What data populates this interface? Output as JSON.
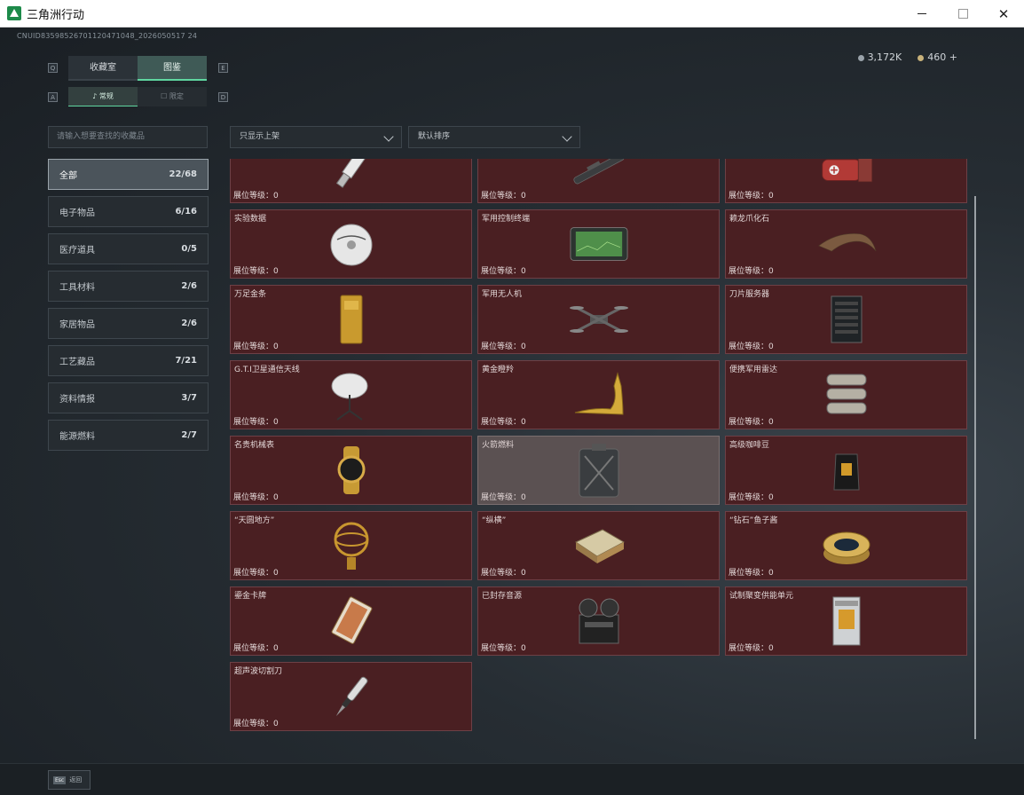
{
  "window": {
    "title": "三角洲行动",
    "controls": [
      "minimize",
      "maximize",
      "close"
    ]
  },
  "header": {
    "uid": "CNUID83598526701120471048_2026050517 24",
    "currency": [
      {
        "icon": "silver-coin-icon",
        "value": "3,172K"
      },
      {
        "icon": "gold-coin-icon",
        "value": "460 +"
      }
    ]
  },
  "key_hints": {
    "q": "Q",
    "e": "E",
    "a": "A",
    "d": "D"
  },
  "tabs": {
    "main": [
      "收藏室",
      "图鉴"
    ],
    "main_active": 1,
    "sub": [
      "常规",
      "限定"
    ],
    "sub_active": 0
  },
  "search": {
    "placeholder": "请输入想要查找的收藏品"
  },
  "filters": {
    "shelf": "只显示上架",
    "sort": "默认排序"
  },
  "categories": [
    {
      "label": "全部",
      "count": "22/68",
      "active": true
    },
    {
      "label": "电子物品",
      "count": "6/16"
    },
    {
      "label": "医疗道具",
      "count": "0/5"
    },
    {
      "label": "工具材料",
      "count": "2/6"
    },
    {
      "label": "家居物品",
      "count": "2/6"
    },
    {
      "label": "工艺藏品",
      "count": "7/21"
    },
    {
      "label": "资料情报",
      "count": "3/7"
    },
    {
      "label": "能源燃料",
      "count": "2/7"
    }
  ],
  "level_label": "展位等级：",
  "items": [
    {
      "name": "",
      "level": "0",
      "icon": "usb-drive-icon"
    },
    {
      "name": "",
      "level": "0",
      "icon": "rifle-scope-icon"
    },
    {
      "name": "",
      "level": "0",
      "icon": "medical-tank-icon"
    },
    {
      "name": "实验数据",
      "level": "0",
      "icon": "data-disc-icon"
    },
    {
      "name": "军用控制终端",
      "level": "0",
      "icon": "control-terminal-icon"
    },
    {
      "name": "赖龙爪化石",
      "level": "0",
      "icon": "fossil-claw-icon"
    },
    {
      "name": "万足金条",
      "level": "0",
      "icon": "gold-bar-icon"
    },
    {
      "name": "军用无人机",
      "level": "0",
      "icon": "drone-icon"
    },
    {
      "name": "刀片服务器",
      "level": "0",
      "icon": "blade-server-icon"
    },
    {
      "name": "G.T.I卫星通信天线",
      "level": "0",
      "icon": "satellite-antenna-icon"
    },
    {
      "name": "黄金瞪羚",
      "level": "0",
      "icon": "gold-gazelle-icon"
    },
    {
      "name": "便携军用雷达",
      "level": "0",
      "icon": "radar-icon"
    },
    {
      "name": "名贵机械表",
      "level": "0",
      "icon": "watch-icon"
    },
    {
      "name": "火箭燃料",
      "level": "0",
      "icon": "fuel-can-icon",
      "dim": true
    },
    {
      "name": "高级咖啡豆",
      "level": "0",
      "icon": "coffee-bag-icon"
    },
    {
      "name": "“天圆地方”",
      "level": "0",
      "icon": "armillary-sphere-icon"
    },
    {
      "name": "“纵横”",
      "level": "0",
      "icon": "chess-board-icon"
    },
    {
      "name": "“钻石”鱼子酱",
      "level": "0",
      "icon": "caviar-tin-icon"
    },
    {
      "name": "鎏金卡牌",
      "level": "0",
      "icon": "gold-card-icon"
    },
    {
      "name": "已封存音源",
      "level": "0",
      "icon": "tape-recorder-icon"
    },
    {
      "name": "试制聚变供能单元",
      "level": "0",
      "icon": "fusion-cell-icon"
    },
    {
      "name": "超声波切割刀",
      "level": "0",
      "icon": "ultrasonic-knife-icon"
    }
  ],
  "footer": {
    "esc_key": "Esc",
    "back_label": "返回"
  },
  "colors": {
    "card_bg": "#4a1f22",
    "accent": "#5fd6a0"
  }
}
